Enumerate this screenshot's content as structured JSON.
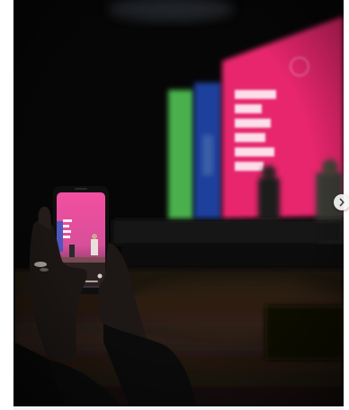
{
  "post": {
    "media_type": "photo",
    "carousel": {
      "next_icon": "chevron-right-icon"
    }
  },
  "colors": {
    "screen_magenta": "#e8276d",
    "screen_green": "#49b04c",
    "screen_blue": "#1f3f9c",
    "backdrop": "#060606"
  }
}
